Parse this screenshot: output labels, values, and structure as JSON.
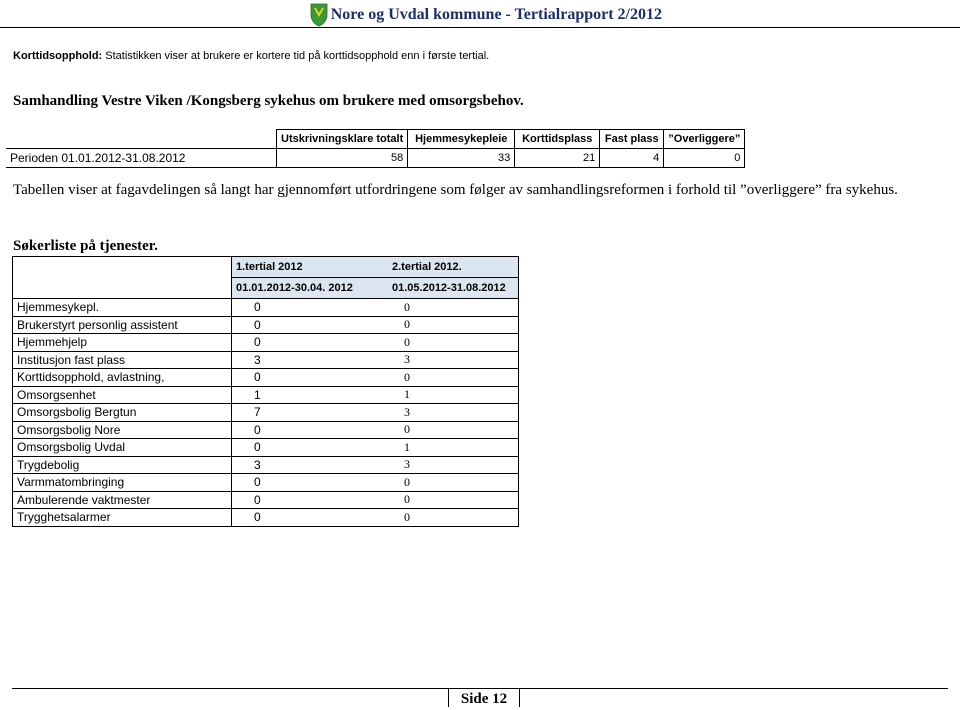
{
  "header": {
    "title": "Nore og Uvdal kommune - Tertialrapport 2/2012"
  },
  "note": {
    "label": "Korttidsopphold:",
    "text": " Statistikken viser at brukere er kortere tid på korttidsopphold enn i første tertial."
  },
  "samhandling": {
    "heading": "Samhandling Vestre Viken /Kongsberg sykehus om brukere med omsorgsbehov.",
    "columns": [
      "Utskrivningsklare totalt",
      "Hjemmesykepleie",
      "Korttidsplass",
      "Fast plass",
      "”Overliggere”"
    ],
    "row_label": "Perioden 01.01.2012-31.08.2012",
    "values": [
      "58",
      "33",
      "21",
      "4",
      "0"
    ]
  },
  "paragraph": "Tabellen viser at fagavdelingen så langt har gjennomført utfordringene som følger av samhandlingsreformen i forhold til ”overliggere” fra sykehus.",
  "sokerliste": {
    "heading": "Søkerliste på tjenester.",
    "col1_title": "1.tertial 2012",
    "col1_period": "01.01.2012-30.04. 2012",
    "col2_title": "2.tertial 2012.",
    "col2_period": "01.05.2012-31.08.2012",
    "rows": [
      {
        "label": "Hjemmesykepl.",
        "t1": "0",
        "t2": "0"
      },
      {
        "label": "Brukerstyrt personlig assistent",
        "t1": "0",
        "t2": "0"
      },
      {
        "label": "Hjemmehjelp",
        "t1": "0",
        "t2": "0"
      },
      {
        "label": "Institusjon fast plass",
        "t1": "3",
        "t2": "3"
      },
      {
        "label": "Korttidsopphold, avlastning,",
        "t1": "0",
        "t2": "0"
      },
      {
        "label": "Omsorgsenhet",
        "t1": "1",
        "t2": "1"
      },
      {
        "label": "Omsorgsbolig Bergtun",
        "t1": "7",
        "t2": "3"
      },
      {
        "label": "Omsorgsbolig Nore",
        "t1": "0",
        "t2": "0"
      },
      {
        "label": "Omsorgsbolig Uvdal",
        "t1": "0",
        "t2": "1"
      },
      {
        "label": "Trygdebolig",
        "t1": "3",
        "t2": "3"
      },
      {
        "label": "Varmmatombringing",
        "t1": "0",
        "t2": "0"
      },
      {
        "label": "Ambulerende vaktmester",
        "t1": "0",
        "t2": "0"
      },
      {
        "label": "Trygghetsalarmer",
        "t1": "0",
        "t2": "0"
      }
    ]
  },
  "footer": {
    "page": "Side 12"
  },
  "colors": {
    "header_title": "#1d2d6a",
    "table_header_bg": "#dce6f1",
    "crest_green": "#3a9a3a",
    "crest_yellow": "#f2d21b"
  }
}
